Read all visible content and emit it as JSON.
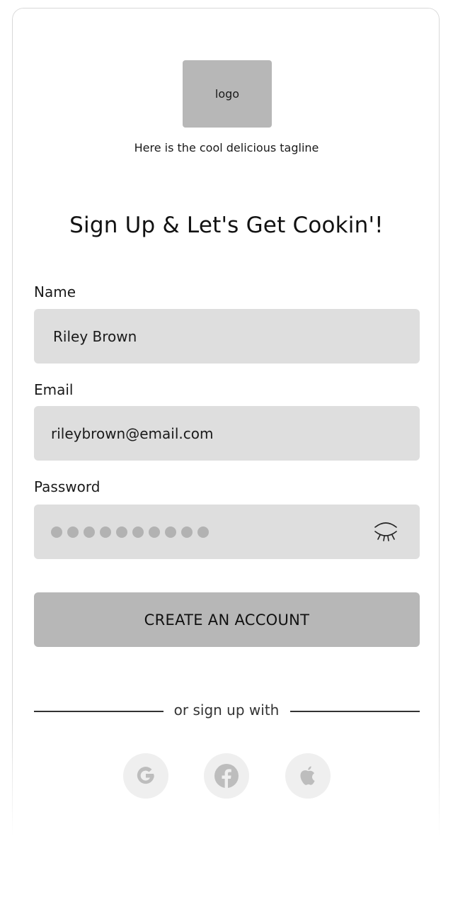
{
  "header": {
    "logo_text": "logo",
    "tagline": "Here is the cool delicious tagline"
  },
  "form": {
    "title": "Sign Up & Let's Get Cookin'!",
    "name_label": "Name",
    "name_value": "Riley Brown",
    "email_label": "Email",
    "email_value": "rileybrown@email.com",
    "password_label": "Password",
    "password_length": 10,
    "submit_label": "CREATE AN ACCOUNT"
  },
  "social": {
    "divider_text": "or sign up with",
    "providers": [
      {
        "name": "Google",
        "icon": "google-icon"
      },
      {
        "name": "Facebook",
        "icon": "facebook-icon"
      },
      {
        "name": "Apple",
        "icon": "apple-icon"
      }
    ]
  },
  "colors": {
    "field_bg": "#dedede",
    "button_bg": "#b7b7b7",
    "social_icon": "#bdbdbd"
  }
}
